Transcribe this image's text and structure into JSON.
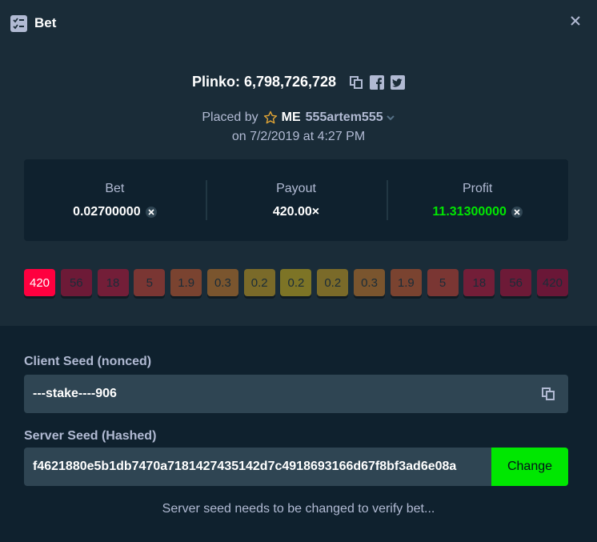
{
  "header": {
    "title": "Bet",
    "icon": "bet-list-icon",
    "close_icon": "close-icon"
  },
  "game": {
    "title": "Plinko: 6,798,726,728",
    "icons": [
      "copy-icon",
      "facebook-icon",
      "twitter-icon"
    ]
  },
  "placed": {
    "prefix": "Placed by",
    "user_tag": "ME",
    "username": "555artem555",
    "date": "on 7/2/2019 at 4:27 PM"
  },
  "stats": {
    "bet_label": "Bet",
    "bet_value": "0.02700000",
    "payout_label": "Payout",
    "payout_value": "420.00×",
    "profit_label": "Profit",
    "profit_value": "11.31300000",
    "profit_color": "#00e701"
  },
  "multipliers": [
    {
      "label": "420",
      "color": "#ff003f",
      "text": "#ffffff",
      "active": true
    },
    {
      "label": "56",
      "color": "#6d1a37",
      "text": "#1a2c38"
    },
    {
      "label": "18",
      "color": "#731e38",
      "text": "#1a2c38"
    },
    {
      "label": "5",
      "color": "#7a3633",
      "text": "#1a2c38"
    },
    {
      "label": "1.9",
      "color": "#7a4330",
      "text": "#1a2c38"
    },
    {
      "label": "0.3",
      "color": "#7a552e",
      "text": "#1a2c38"
    },
    {
      "label": "0.2",
      "color": "#7a6a29",
      "text": "#1a2c38"
    },
    {
      "label": "0.2",
      "color": "#7d7426",
      "text": "#1a2c38"
    },
    {
      "label": "0.2",
      "color": "#7a6a29",
      "text": "#1a2c38"
    },
    {
      "label": "0.3",
      "color": "#7a552e",
      "text": "#1a2c38"
    },
    {
      "label": "1.9",
      "color": "#7a4330",
      "text": "#1a2c38"
    },
    {
      "label": "5",
      "color": "#7a3633",
      "text": "#1a2c38"
    },
    {
      "label": "18",
      "color": "#731e38",
      "text": "#1a2c38"
    },
    {
      "label": "56",
      "color": "#6d1a37",
      "text": "#1a2c38"
    },
    {
      "label": "420",
      "color": "#6a1737",
      "text": "#1a2c38"
    }
  ],
  "client_seed": {
    "label": "Client Seed (nonced)",
    "value": "---stake----906"
  },
  "server_seed": {
    "label": "Server Seed (Hashed)",
    "value": "f4621880e5b1db7470a7181427435142d7c4918693166d67f8bf3ad6e08a",
    "button": "Change"
  },
  "note": "Server seed needs to be changed to verify bet..."
}
